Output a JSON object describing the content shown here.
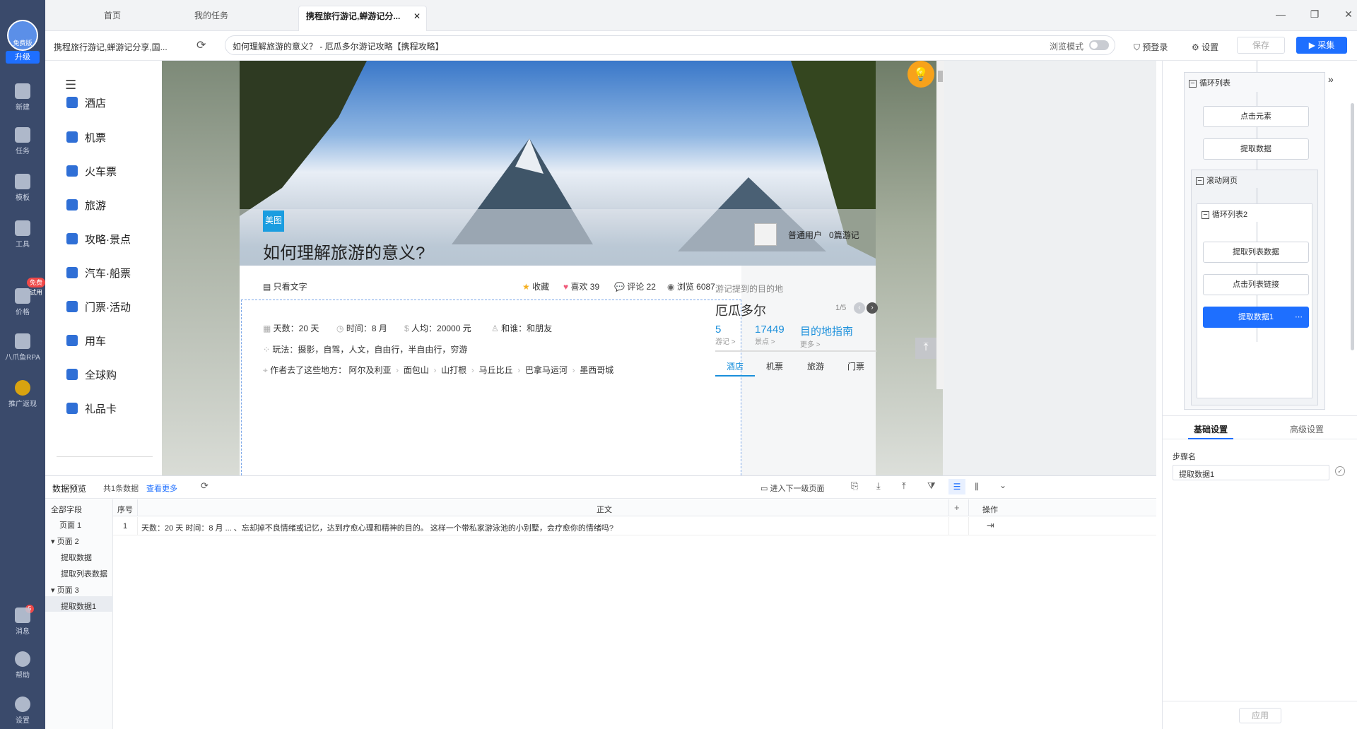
{
  "rail": {
    "avatar_badge": "免费版",
    "upgrade": "升级",
    "items": [
      "新建",
      "任务",
      "模板",
      "工具",
      "价格",
      "八爪鱼RPA",
      "推广返现",
      "消息",
      "帮助",
      "设置"
    ],
    "price_badge": "免费试用",
    "msg_count": "5"
  },
  "tabs": [
    "首页",
    "我的任务",
    "携程旅行游记,蝉游记分..."
  ],
  "addr": {
    "site": "携程旅行游记,蝉游记分享,国...",
    "url": "如何理解旅游的意义？ - 厄瓜多尔游记攻略【携程攻略】",
    "browse_mode": "浏览模式",
    "prelogin": "预登录",
    "settings": "设置",
    "save": "保存",
    "collect": "▶ 采集"
  },
  "nav": [
    "酒店",
    "机票",
    "火车票",
    "旅游",
    "攻略·景点",
    "汽车·船票",
    "门票·活动",
    "用车",
    "全球购",
    "礼品卡"
  ],
  "hero": {
    "tag": "美图",
    "title": "如何理解旅游的意义?",
    "user": "普通用户",
    "notes": "0篇游记"
  },
  "toolbar": {
    "text_only": "只看文字",
    "fav": "收藏",
    "like": "喜欢 39",
    "comment": "评论 22",
    "views": "浏览  6087"
  },
  "info": {
    "days": "天数：20 天",
    "time": "时间：8 月",
    "avg": "人均：20000 元",
    "with": "和谁：和朋友",
    "play": "玩法：摄影，自驾，人文，自由行，半自由行，穷游",
    "visited_label": "作者去了这些地方：",
    "places": [
      "阿尔及利亚",
      "面包山",
      "山打根",
      "马丘比丘",
      "巴拿马运河",
      "墨西哥城"
    ]
  },
  "dest": {
    "heading": "游记提到的目的地",
    "name": "厄瓜多尔",
    "pager": "1/5",
    "stats": [
      {
        "num": "5",
        "label": "游记 >"
      },
      {
        "num": "17449",
        "label": "景点 >"
      },
      {
        "num": "目的地指南",
        "label": "更多 >"
      }
    ],
    "tabs": [
      "酒店",
      "机票",
      "旅游",
      "门票"
    ]
  },
  "preview": {
    "title": "数据预览",
    "count": "共1条数据",
    "more": "查看更多",
    "next_level": "进入下一级页面",
    "tree": [
      {
        "label": "全部字段",
        "indent": 0
      },
      {
        "label": "页面 1",
        "indent": 1
      },
      {
        "label": "▾ 页面 2",
        "indent": 0
      },
      {
        "label": "提取数据",
        "indent": 2
      },
      {
        "label": "提取列表数据",
        "indent": 2
      },
      {
        "label": "▾ 页面 3",
        "indent": 0
      },
      {
        "label": "提取数据1",
        "indent": 2
      }
    ],
    "col_index": "序号",
    "col_body": "正文",
    "col_add": "+",
    "col_op": "操作",
    "rows": [
      {
        "idx": "1",
        "text": "天数：20 天 时间：8 月 ... 、忘却掉不良情绪或记忆，达到疗愈心理和精神的目的。 这样一个带私家游泳池的小别墅，会疗愈你的情绪吗?"
      }
    ]
  },
  "flow": {
    "loop": "循环列表",
    "click": "点击元素",
    "extract": "提取数据",
    "scroll": "滚动网页",
    "loop2": "循环列表2",
    "extract_list": "提取列表数据",
    "click_link": "点击列表链接",
    "extract1": "提取数据1",
    "tab_basic": "基础设置",
    "tab_adv": "高级设置",
    "step_label": "步骤名",
    "step_value": "提取数据1",
    "apply": "应用"
  },
  "colors": {
    "accent": "#1e6fff",
    "rail": "#3a4a6b",
    "link": "#1a8fdb"
  }
}
